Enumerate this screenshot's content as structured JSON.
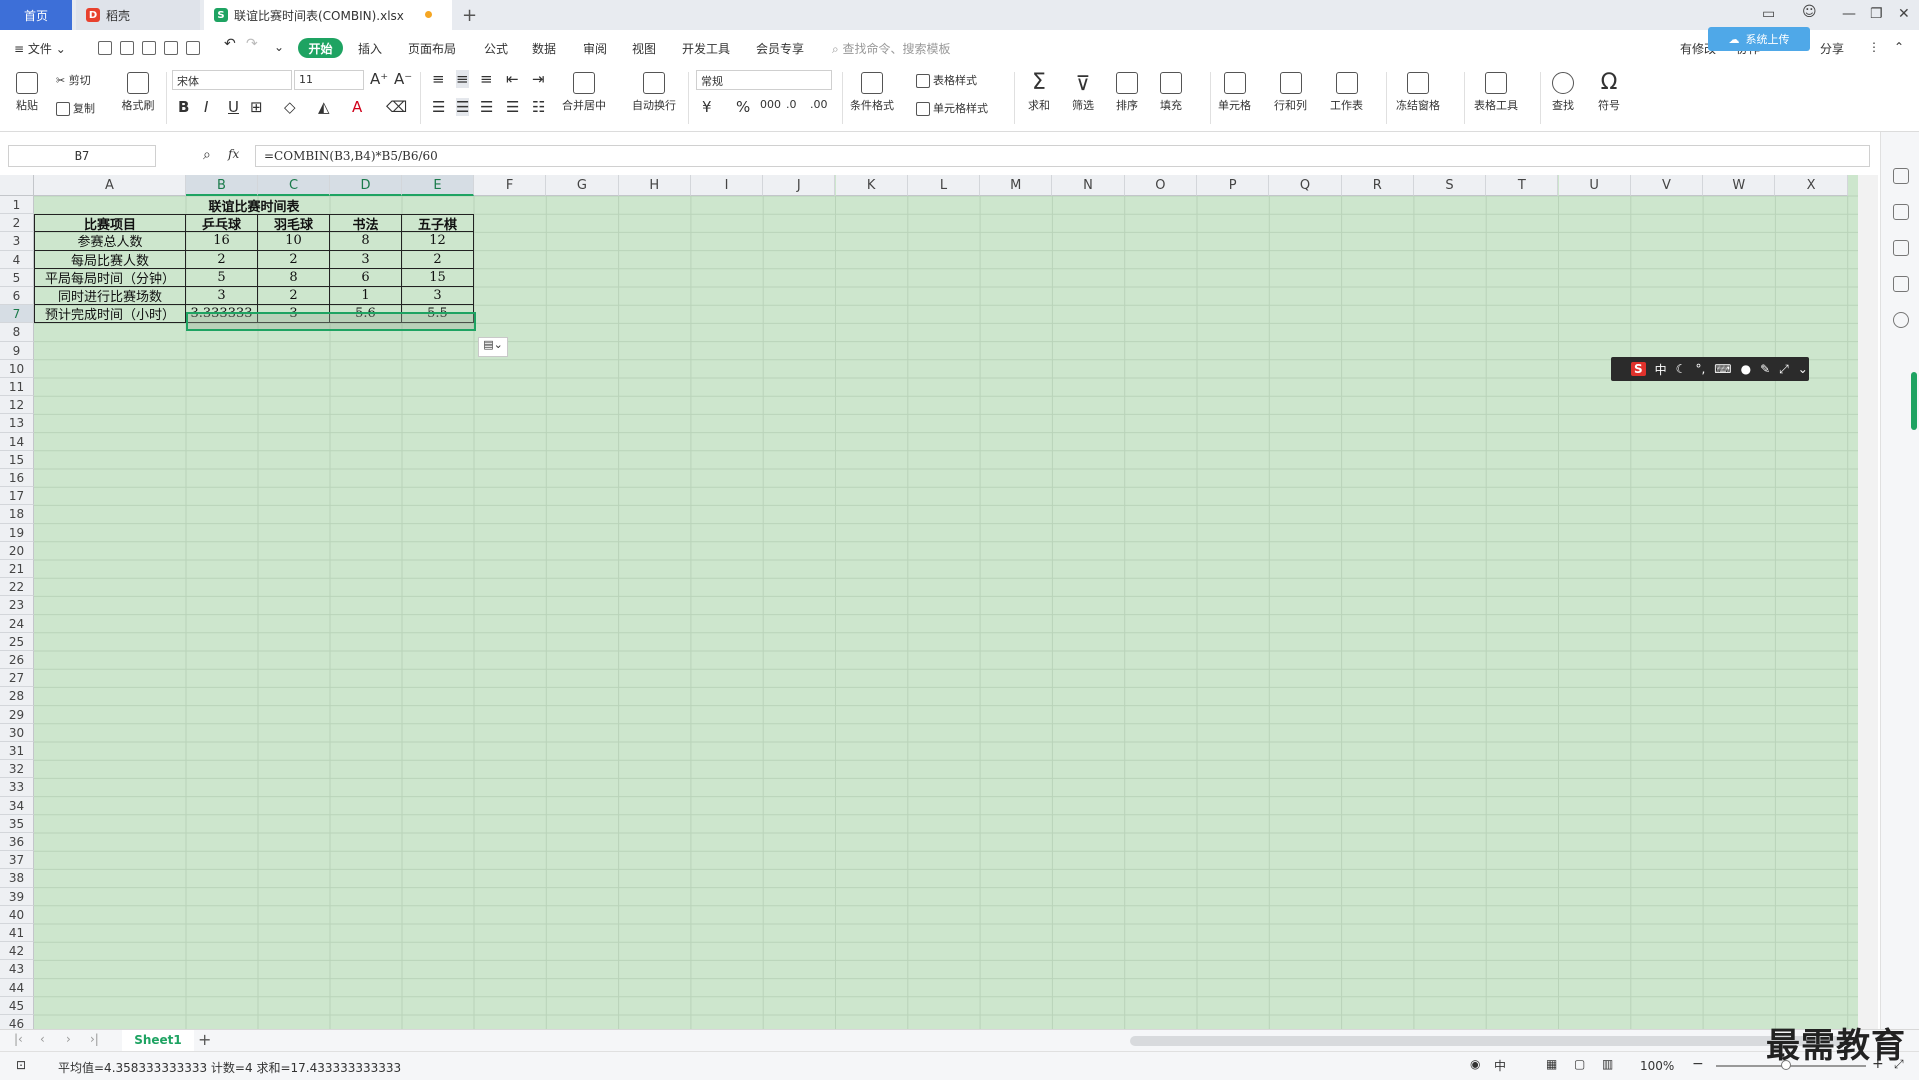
{
  "titlebar": {
    "home_tab": "首页",
    "doc_tab": "稻壳",
    "file_tab": "联谊比赛时间表(COMBIN).xlsx",
    "cloud_button": "系统上传"
  },
  "menubar": {
    "file_menu": "文件",
    "active_tab": "开始",
    "tabs": [
      "插入",
      "页面布局",
      "公式",
      "数据",
      "审阅",
      "视图",
      "开发工具",
      "会员专享"
    ],
    "search_placeholder": "查找命令、搜索模板",
    "right_items": [
      "有修改",
      "协作",
      "分享"
    ]
  },
  "ribbon": {
    "paste": "粘贴",
    "cut": "剪切",
    "copy": "复制",
    "format_painter": "格式刷",
    "font_name": "宋体",
    "font_size": "11",
    "merge_center": "合并居中",
    "wrap_text": "自动换行",
    "number_format": "常规",
    "conditional_format": "条件格式",
    "table_style": "表格样式",
    "cell_style": "单元格样式",
    "sum": "求和",
    "filter": "筛选",
    "sort": "排序",
    "fill": "填充",
    "cell": "单元格",
    "row_col": "行和列",
    "worksheet": "工作表",
    "freeze": "冻结窗格",
    "table_tools": "表格工具",
    "find": "查找",
    "symbol": "符号"
  },
  "formula_bar": {
    "name_box": "B7",
    "fx": "fx",
    "formula": "=COMBIN(B3,B4)*B5/B6/60"
  },
  "columns": [
    "A",
    "B",
    "C",
    "D",
    "E",
    "F",
    "G",
    "H",
    "I",
    "J",
    "K",
    "L",
    "M",
    "N",
    "O",
    "P",
    "Q",
    "R",
    "S",
    "T",
    "U",
    "V",
    "W",
    "X"
  ],
  "rows": [
    "1",
    "2",
    "3",
    "4",
    "5",
    "6",
    "7",
    "8",
    "9",
    "10",
    "11",
    "12",
    "13",
    "14",
    "15",
    "16",
    "17",
    "18",
    "19",
    "20",
    "21",
    "22",
    "23",
    "24",
    "25",
    "26",
    "27",
    "28",
    "29",
    "30",
    "31",
    "32",
    "33",
    "34",
    "35",
    "36",
    "37",
    "38",
    "39",
    "40",
    "41",
    "42",
    "43",
    "44",
    "45",
    "46"
  ],
  "table": {
    "title": "联谊比赛时间表",
    "headers": [
      "比赛项目",
      "乒乓球",
      "羽毛球",
      "书法",
      "五子棋"
    ],
    "rows": [
      [
        "参赛总人数",
        "16",
        "10",
        "8",
        "12"
      ],
      [
        "每局比赛人数",
        "2",
        "2",
        "3",
        "2"
      ],
      [
        "平局每局时间（分钟）",
        "5",
        "8",
        "6",
        "15"
      ],
      [
        "同时进行比赛场数",
        "3",
        "2",
        "1",
        "3"
      ],
      [
        "预计完成时间（小时）",
        "3.333333",
        "3",
        "5.6",
        "5.5"
      ]
    ]
  },
  "ime_toolbar": {
    "logo": "S",
    "mode": "中"
  },
  "sheets": [
    "Sheet1"
  ],
  "statusbar": {
    "summary": "平均值=4.358333333333  计数=4  求和=17.433333333333",
    "zoom": "100%"
  },
  "watermark": "最需教育",
  "colors": {
    "accent": "#1ea362",
    "home_tab": "#3d6fd8",
    "grid_bg": "#cde6cd"
  }
}
